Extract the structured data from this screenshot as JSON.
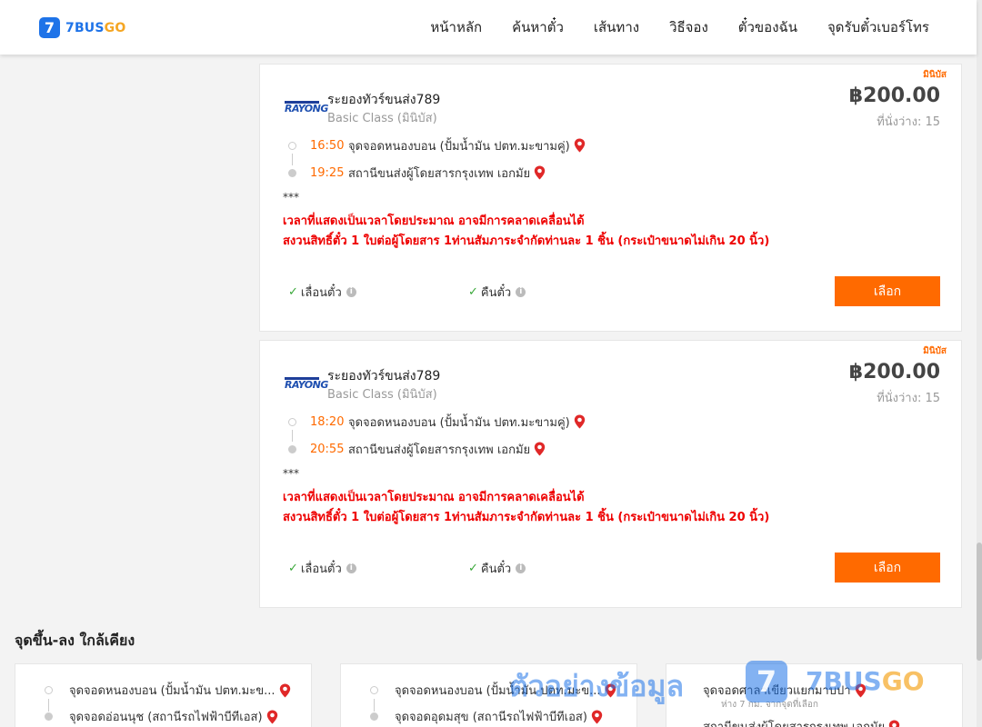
{
  "header": {
    "logo_digit": "7",
    "logo_text_a": "7BUS",
    "logo_text_b": "GO",
    "nav": [
      "หน้าหลัก",
      "ค้นหาตั๋ว",
      "เส้นทาง",
      "วิธีจอง",
      "ตั๋วของฉัน",
      "จุดรับตั๋วเบอร์โทร"
    ]
  },
  "trips": [
    {
      "vehicle_type": "มินิบัส",
      "operator_logo_text": "RAYONG",
      "operator": "ระยองทัวร์ขนส่ง789",
      "class": "Basic Class (มินิบัส)",
      "price": "฿200.00",
      "seats": "ที่นั่งว่าง: 15",
      "depart_time": "16:50",
      "depart_stop": "จุดจอดหนองบอน (ปั้มน้ำมัน ปตท.มะขามคู่)",
      "arrive_time": "19:25",
      "arrive_stop": "สถานีขนส่งผู้โดยสารกรุงเทพ เอกมัย",
      "stars": "***",
      "note1": "เวลาที่แสดงเป็นเวลาโดยประมาณ อาจมีการคลาดเคลื่อนได้",
      "note2": "สงวนสิทธิ์ตั๋ว 1 ใบต่อผู้โดยสาร 1ท่านสัมภาระจำกัดท่านละ 1 ชิ้น (กระเป๋าขนาดไม่เกิน 20 นิ้ว)",
      "policy1": "เลื่อนตั๋ว",
      "policy2": "คืนตั๋ว",
      "select_label": "เลือก"
    },
    {
      "vehicle_type": "มินิบัส",
      "operator_logo_text": "RAYONG",
      "operator": "ระยองทัวร์ขนส่ง789",
      "class": "Basic Class (มินิบัส)",
      "price": "฿200.00",
      "seats": "ที่นั่งว่าง: 15",
      "depart_time": "18:20",
      "depart_stop": "จุดจอดหนองบอน (ปั้มน้ำมัน ปตท.มะขามคู่)",
      "arrive_time": "20:55",
      "arrive_stop": "สถานีขนส่งผู้โดยสารกรุงเทพ เอกมัย",
      "stars": "***",
      "note1": "เวลาที่แสดงเป็นเวลาโดยประมาณ อาจมีการคลาดเคลื่อนได้",
      "note2": "สงวนสิทธิ์ตั๋ว 1 ใบต่อผู้โดยสาร 1ท่านสัมภาระจำกัดท่านละ 1 ชิ้น (กระเป๋าขนาดไม่เกิน 20 นิ้ว)",
      "policy1": "เลื่อนตั๋ว",
      "policy2": "คืนตั๋ว",
      "select_label": "เลือก"
    }
  ],
  "nearby": {
    "title": "จุดขึ้น-ลง ใกล้เคียง",
    "cards": [
      {
        "from": "จุดจอดหนองบอน (ปั้มน้ำมัน ปตท.มะข...",
        "to": "จุดจอดอ่อนนุช (สถานีรถไฟฟ้าบีทีเอส)",
        "sub": ""
      },
      {
        "from": "จุดจอดหนองบอน (ปั้มน้ำมัน ปตท.มะข...",
        "to": "จุดจอดอุดมสุข (สถานีรถไฟฟ้าบีทีเอส)",
        "sub": ""
      },
      {
        "from": "จุดจอดศาลาเขียวแยกมาบปา",
        "to": "สถานีขนส่งผู้โดยสารกรุงเทพ เอกมัย",
        "sub": "ห่าง 7 กม. จากจุดที่เลือก"
      }
    ]
  },
  "watermark": {
    "text": "ตัวอย่างข้อมูล",
    "digit": "7",
    "brand_a": "7BUS",
    "brand_b": "GO"
  },
  "colors": {
    "accent": "#ff6a00",
    "brand_blue": "#1e73e8",
    "brand_orange": "#f5a623",
    "notice_red": "#e00000",
    "check_green": "#3aa83a"
  }
}
